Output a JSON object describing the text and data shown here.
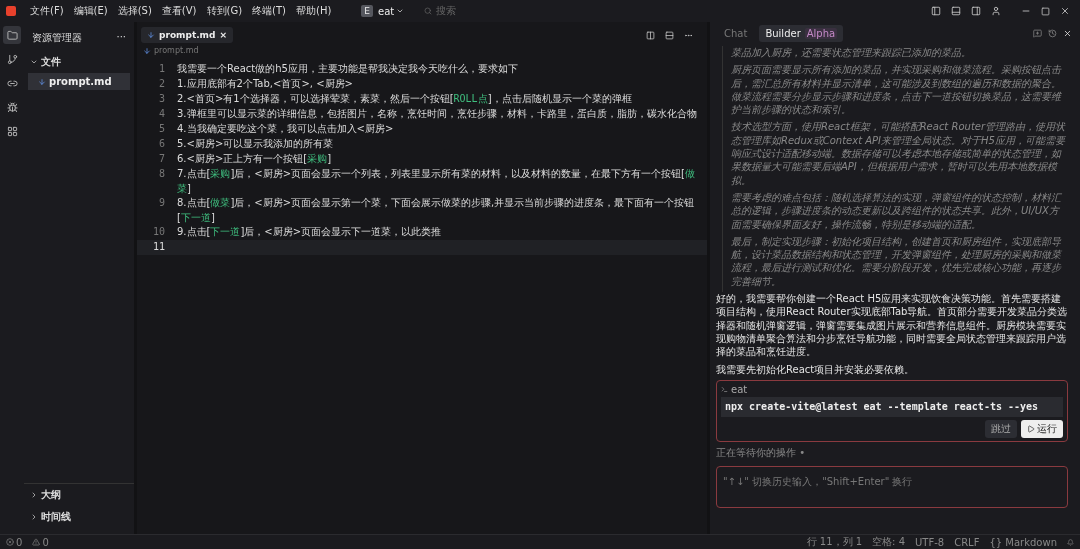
{
  "menu": [
    "文件(F)",
    "编辑(E)",
    "选择(S)",
    "查看(V)",
    "转到(G)",
    "终端(T)",
    "帮助(H)"
  ],
  "workspace": {
    "badge": "E",
    "name": "eat"
  },
  "search": {
    "placeholder": "搜索"
  },
  "sidebar": {
    "title": "资源管理器",
    "more": "···",
    "section": "文件",
    "files": [
      {
        "name": "prompt.md",
        "selected": true
      }
    ],
    "bottom": [
      "大纲",
      "时间线"
    ]
  },
  "activity": [
    {
      "kind": "files",
      "selected": true
    },
    {
      "kind": "branch",
      "selected": false
    },
    {
      "kind": "link",
      "selected": false
    },
    {
      "kind": "bug",
      "selected": false
    },
    {
      "kind": "grid",
      "selected": false
    }
  ],
  "editor": {
    "tab": "prompt.md",
    "close": "×",
    "breadcrumb": "prompt.md",
    "lines": [
      {
        "no": "1",
        "selected": false,
        "segments": [
          {
            "kind": "plain",
            "text": "我需要一个React做的h5应用，主要功能是帮我决定我今天吃什么，要求如下"
          }
        ]
      },
      {
        "no": "2",
        "selected": false,
        "segments": [
          {
            "kind": "plain",
            "text": "1.应用底部有2个Tab,<首页>, <厨房>"
          }
        ]
      },
      {
        "no": "3",
        "selected": false,
        "segments": [
          {
            "kind": "plain",
            "text": "2.<首页>有1个选择器，可以选择荤菜，素菜，然后一个按钮["
          },
          {
            "kind": "code",
            "text": "ROLL点"
          },
          {
            "kind": "plain",
            "text": "]，点击后随机显示一个菜的弹框"
          }
        ]
      },
      {
        "no": "4",
        "selected": false,
        "segments": [
          {
            "kind": "plain",
            "text": "3.弹框里可以显示菜的详细信息，包括图片，名称，烹饪时间，烹饪步骤，材料，卡路里，蛋白质，脂肪，碳水化合物"
          }
        ]
      },
      {
        "no": "5",
        "selected": false,
        "segments": [
          {
            "kind": "plain",
            "text": "4.当我确定要吃这个菜，我可以点击加入<厨房>"
          }
        ]
      },
      {
        "no": "6",
        "selected": false,
        "segments": [
          {
            "kind": "plain",
            "text": "5.<厨房>可以显示我添加的所有菜"
          }
        ]
      },
      {
        "no": "7",
        "selected": false,
        "segments": [
          {
            "kind": "plain",
            "text": "6.<厨房>正上方有一个按钮["
          },
          {
            "kind": "code",
            "text": "采购"
          },
          {
            "kind": "plain",
            "text": "]"
          }
        ]
      },
      {
        "no": "8",
        "selected": false,
        "segments": [
          {
            "kind": "plain",
            "text": "7.点击["
          },
          {
            "kind": "code",
            "text": "采购"
          },
          {
            "kind": "plain",
            "text": "]后，<厨房>页面会显示一个列表，列表里显示所有菜的材料，以及材料的数量，在最下方有一个按钮["
          },
          {
            "kind": "code",
            "text": "做菜"
          },
          {
            "kind": "plain",
            "text": "]"
          }
        ]
      },
      {
        "no": "9",
        "selected": false,
        "segments": [
          {
            "kind": "plain",
            "text": "8.点击["
          },
          {
            "kind": "code",
            "text": "做菜"
          },
          {
            "kind": "plain",
            "text": "]后，<厨房>页面会显示第一个菜，下面会展示做菜的步骤,并显示当前步骤的进度条，最下面有一个按钮["
          },
          {
            "kind": "code",
            "text": "下一道"
          },
          {
            "kind": "plain",
            "text": "]"
          }
        ]
      },
      {
        "no": "10",
        "selected": false,
        "segments": [
          {
            "kind": "plain",
            "text": "9.点击["
          },
          {
            "kind": "code",
            "text": "下一道"
          },
          {
            "kind": "plain",
            "text": "]后，<厨房>页面会显示下一道菜，以此类推"
          }
        ]
      },
      {
        "no": "11",
        "selected": true
      }
    ]
  },
  "chat": {
    "tabs": [
      {
        "label": "Chat",
        "selected": false
      },
      {
        "label": "Builder",
        "badge": "Alpha",
        "selected": true
      }
    ],
    "thinking": [
      "菜品加入厨房，还需要状态管理来跟踪已添加的菜品。",
      "厨房页面需要显示所有添加的菜品，并实现采购和做菜流程。采购按钮点击后，需汇总所有材料并显示清单，这可能涉及到数组的遍历和数据的聚合。做菜流程需要分步显示步骤和进度条，点击下一道按钮切换菜品，这需要维护当前步骤的状态和索引。",
      "技术选型方面，使用React框架，可能搭配React Router管理路由，使用状态管理库如Redux或Context API来管理全局状态。对于H5应用，可能需要响应式设计适配移动端。数据存储可以考虑本地存储或简单的状态管理，如果数据量大可能需要后端API，但根据用户需求，暂时可以先用本地数据模拟。",
      "需要考虑的难点包括：随机选择算法的实现，弹窗组件的状态控制，材料汇总的逻辑，步骤进度条的动态更新以及跨组件的状态共享。此外，UI/UX方面需要确保界面友好，操作流畅，特别是移动端的适配。",
      "最后，制定实现步骤：初始化项目结构，创建首页和厨房组件，实现底部导航，设计菜品数据结构和状态管理，开发弹窗组件，处理厨房的采购和做菜流程，最后进行测试和优化。需要分阶段开发，优先完成核心功能，再逐步完善细节。"
    ],
    "answer": [
      "好的，我需要帮你创建一个React H5应用来实现饮食决策功能。首先需要搭建项目结构，使用React Router实现底部Tab导航。首页部分需要开发菜品分类选择器和随机弹窗逻辑，弹窗需要集成图片展示和营养信息组件。厨房模块需要实现购物清单聚合算法和分步烹饪导航功能，同时需要全局状态管理来跟踪用户选择的菜品和烹饪进度。",
      "我需要先初始化React项目并安装必要依赖。"
    ],
    "command": {
      "title": "eat",
      "code": "npx create-vite@latest eat --template react-ts --yes",
      "skip": "跳过",
      "run": "运行"
    },
    "waiting": "正在等待你的操作 •",
    "input": {
      "placeholder": "\"↑↓\" 切换历史输入，\"Shift+Enter\" 换行"
    }
  },
  "status": {
    "errors": "0",
    "warnings": "0",
    "items": [
      "行 11，列 1",
      "空格: 4",
      "UTF-8",
      "CRLF",
      "{} Markdown"
    ]
  }
}
